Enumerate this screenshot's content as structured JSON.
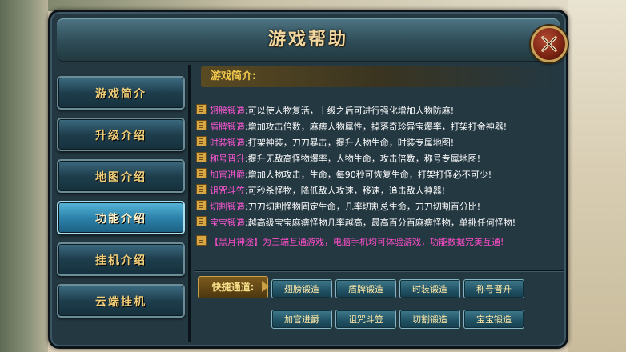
{
  "window": {
    "title": "游戏帮助"
  },
  "sidebar": {
    "items": [
      {
        "label": "游戏简介"
      },
      {
        "label": "升级介绍"
      },
      {
        "label": "地图介绍"
      },
      {
        "label": "功能介绍",
        "active": true
      },
      {
        "label": "挂机介绍"
      },
      {
        "label": "云端挂机"
      }
    ]
  },
  "content": {
    "header": "游戏简介:",
    "lines": [
      {
        "name": "翅膀锻造",
        "desc": ":可以使人物复活，十级之后可进行强化增加人物防麻!"
      },
      {
        "name": "盾牌锻造",
        "desc": ":增加攻击倍数，麻痹人物属性，掉落奇珍异宝爆率，打架打金神器!"
      },
      {
        "name": "时装锻造",
        "desc": ":打架神装，刀刀暴击，提升人物生命，时装专属地图!"
      },
      {
        "name": "称号晋升",
        "desc": ":提升无敌高怪物爆率，人物生命，攻击倍数，称号专属地图!"
      },
      {
        "name": "加官进爵",
        "desc": ":增加人物攻击，生命，每90秒可恢复生命，打架打怪必不可少!"
      },
      {
        "name": "诅咒斗笠",
        "desc": ":可秒杀怪物，降低敌人攻速，移速，追击敌人神器!"
      },
      {
        "name": "切割锻造",
        "desc": ":刀刀切割怪物固定生命，几率切割总生命，刀刀切割百分比!"
      },
      {
        "name": "宝宝锻造",
        "desc": ":越高级宝宝麻痹怪物几率越高，最高百分百麻痹怪物，单挑任何怪物!"
      },
      {
        "name": "【黑月神途】",
        "desc": "为三端互通游戏，电脑手机均可体验游戏，功能数据完美互通!",
        "special": true
      }
    ]
  },
  "quick": {
    "label": "快捷通道:",
    "buttons": [
      "翅膀锻造",
      "盾牌锻造",
      "时装锻造",
      "称号晋升",
      "加官进爵",
      "诅咒斗笠",
      "切割锻造",
      "宝宝锻造"
    ]
  },
  "colors": {
    "window_bg": "#243842",
    "title_text": "#f2d8a0",
    "menu_text": "#f1cf7a",
    "feature_name": "#ff57d6",
    "header_text": "#f2c94c"
  },
  "icons": {
    "close": "close-icon",
    "line": "document-icon"
  }
}
